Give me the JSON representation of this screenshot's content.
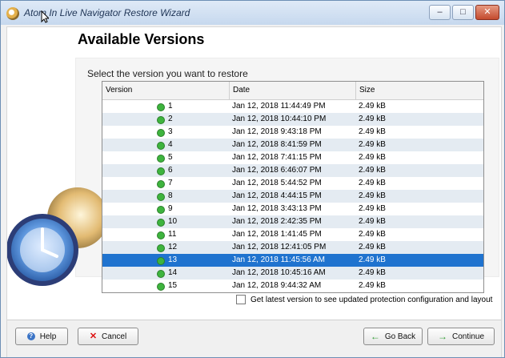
{
  "window": {
    "title": "Atom In Live Navigator Restore Wizard"
  },
  "page": {
    "title": "Available Versions",
    "instruction": "Select the version you want to restore"
  },
  "table": {
    "columns": [
      "Version",
      "Date",
      "Size"
    ],
    "rows": [
      {
        "version": "1",
        "date": "Jan 12, 2018 11:44:49 PM",
        "size": "2.49 kB"
      },
      {
        "version": "2",
        "date": "Jan 12, 2018 10:44:10 PM",
        "size": "2.49 kB"
      },
      {
        "version": "3",
        "date": "Jan 12, 2018 9:43:18 PM",
        "size": "2.49 kB"
      },
      {
        "version": "4",
        "date": "Jan 12, 2018 8:41:59 PM",
        "size": "2.49 kB"
      },
      {
        "version": "5",
        "date": "Jan 12, 2018 7:41:15 PM",
        "size": "2.49 kB"
      },
      {
        "version": "6",
        "date": "Jan 12, 2018 6:46:07 PM",
        "size": "2.49 kB"
      },
      {
        "version": "7",
        "date": "Jan 12, 2018 5:44:52 PM",
        "size": "2.49 kB"
      },
      {
        "version": "8",
        "date": "Jan 12, 2018 4:44:15 PM",
        "size": "2.49 kB"
      },
      {
        "version": "9",
        "date": "Jan 12, 2018 3:43:13 PM",
        "size": "2.49 kB"
      },
      {
        "version": "10",
        "date": "Jan 12, 2018 2:42:35 PM",
        "size": "2.49 kB"
      },
      {
        "version": "11",
        "date": "Jan 12, 2018 1:41:45 PM",
        "size": "2.49 kB"
      },
      {
        "version": "12",
        "date": "Jan 12, 2018 12:41:05 PM",
        "size": "2.49 kB"
      },
      {
        "version": "13",
        "date": "Jan 12, 2018 11:45:56 AM",
        "size": "2.49 kB"
      },
      {
        "version": "14",
        "date": "Jan 12, 2018 10:45:16 AM",
        "size": "2.49 kB"
      },
      {
        "version": "15",
        "date": "Jan 12, 2018 9:44:32 AM",
        "size": "2.49 kB"
      }
    ],
    "selected_version": "13"
  },
  "checkbox": {
    "label": "Get latest version to see updated protection configuration and layout",
    "checked": false
  },
  "buttons": {
    "help": "Help",
    "cancel": "Cancel",
    "back": "Go Back",
    "continue": "Continue"
  },
  "colors": {
    "selected_row": "#1f73cf",
    "success_icon": "#3eb43e",
    "title_bar": "#c6d8ee"
  },
  "icons": {
    "app": "app-clock-icon",
    "minimize": "minimize-icon",
    "maximize": "maximize-icon",
    "close": "close-icon",
    "version_ok": "check-circle-icon",
    "help": "help-icon",
    "cancel": "cancel-icon",
    "back": "back-arrow-icon",
    "continue": "continue-arrow-icon"
  }
}
